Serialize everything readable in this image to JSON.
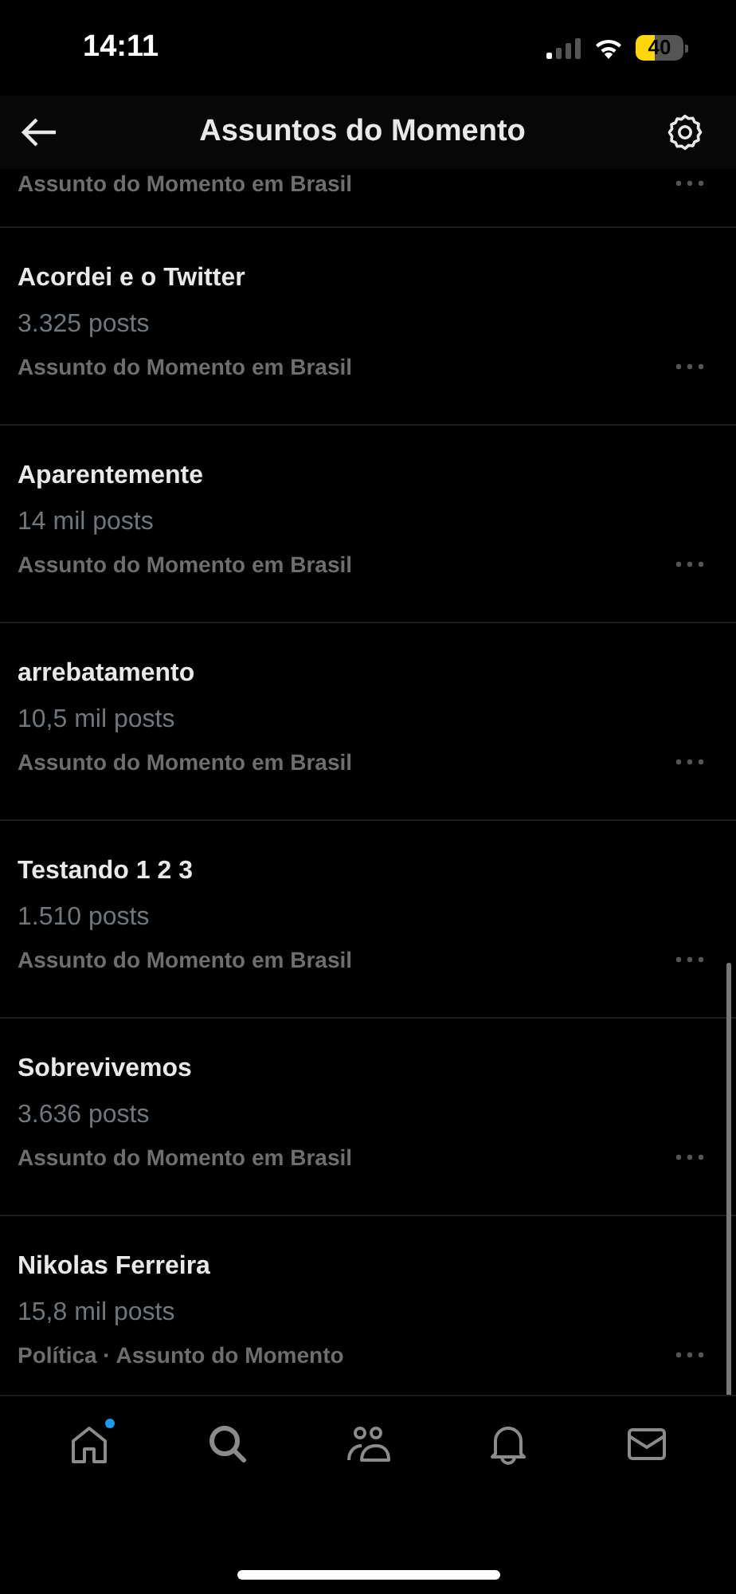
{
  "status_bar": {
    "time": "14:11",
    "battery": {
      "text": "40",
      "level": 0.4
    }
  },
  "header": {
    "title": "Assuntos do Momento"
  },
  "trends": [
    {
      "kind": "partial",
      "context": "Assunto do Momento em Brasil"
    },
    {
      "kind": "full",
      "title": "Acordei e o Twitter",
      "posts": "3.325 posts",
      "context": "Assunto do Momento em Brasil"
    },
    {
      "kind": "full",
      "title": "Aparentemente",
      "posts": "14 mil posts",
      "context": "Assunto do Momento em Brasil"
    },
    {
      "kind": "full",
      "title": "arrebatamento",
      "posts": "10,5 mil posts",
      "context": "Assunto do Momento em Brasil"
    },
    {
      "kind": "full",
      "title": "Testando 1 2 3",
      "posts": "1.510 posts",
      "context": "Assunto do Momento em Brasil"
    },
    {
      "kind": "full",
      "title": "Sobrevivemos",
      "posts": "3.636 posts",
      "context": "Assunto do Momento em Brasil"
    },
    {
      "kind": "full",
      "title": "Nikolas Ferreira",
      "posts": "15,8 mil posts",
      "context": "Política · Assunto do Momento"
    }
  ],
  "tab_bar": [
    {
      "kind": "home",
      "dot": true
    },
    {
      "kind": "search",
      "dot": false
    },
    {
      "kind": "communities",
      "dot": false
    },
    {
      "kind": "notifications",
      "dot": false
    },
    {
      "kind": "messages",
      "dot": false
    }
  ]
}
